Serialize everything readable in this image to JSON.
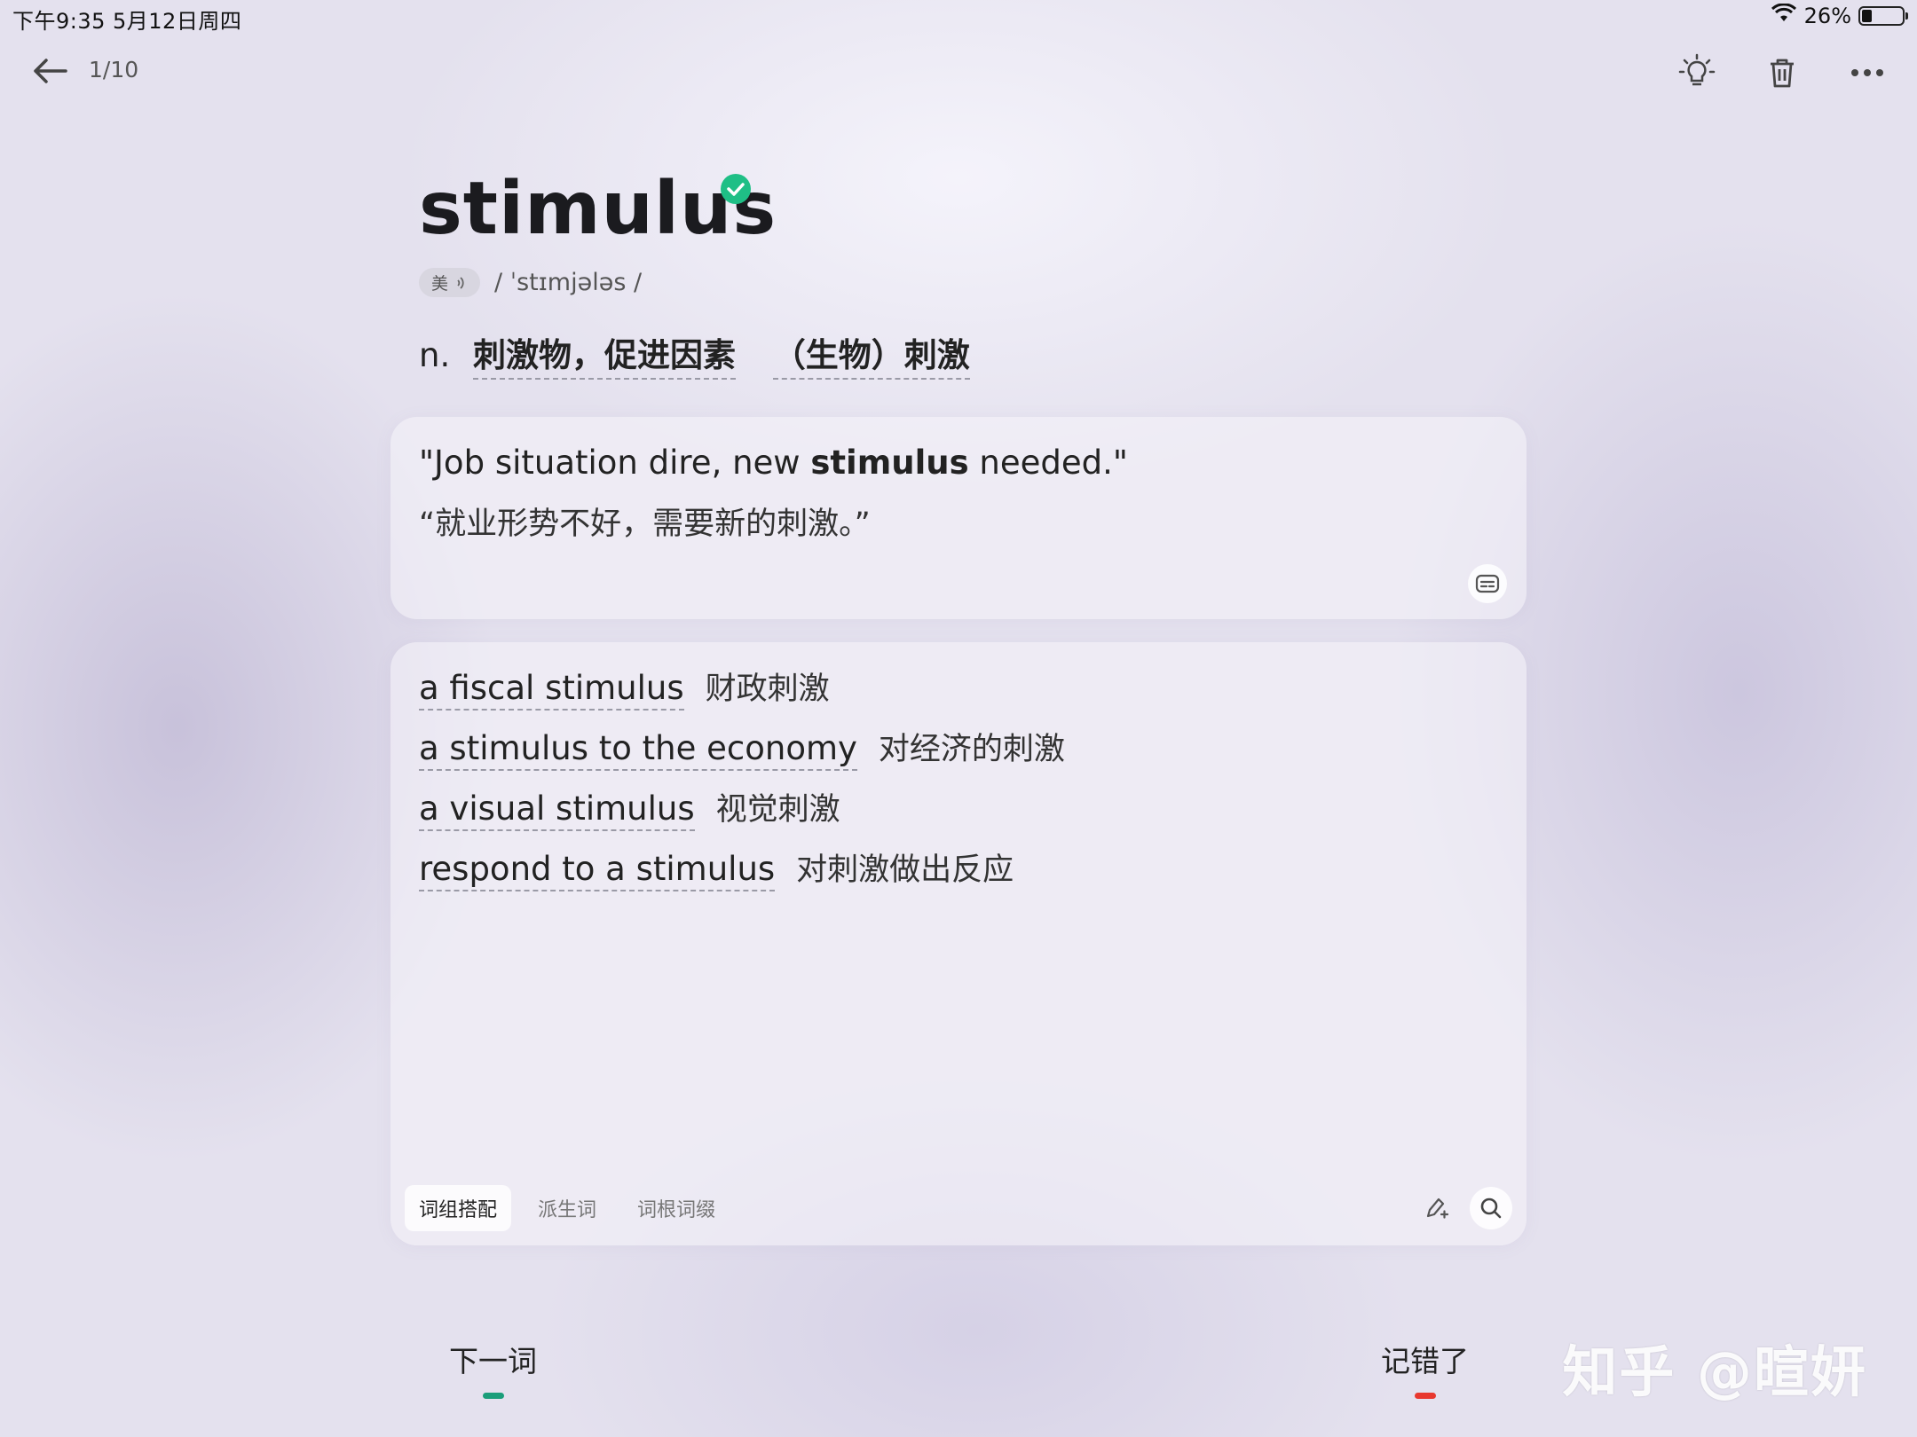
{
  "status_bar": {
    "time_date": "下午9:35   5月12日周四",
    "battery": "26%",
    "battery_level": 0.26
  },
  "topbar": {
    "progress": "1/10"
  },
  "word": {
    "headword": "stimulus",
    "accent_label": "美",
    "phonetic": "/ ˈstɪmjələs /",
    "pos": "n.",
    "definitions": [
      "刺激物，促进因素",
      "（生物）刺激"
    ]
  },
  "example": {
    "en_before": "\"Job situation dire, new ",
    "en_bold": "stimulus",
    "en_after": " needed.\"",
    "zh": "“就业形势不好，需要新的刺激。”"
  },
  "phrases": [
    {
      "en": "a fiscal stimulus",
      "zh": "财政刺激"
    },
    {
      "en": "a stimulus to the economy",
      "zh": "对经济的刺激"
    },
    {
      "en": "a visual stimulus",
      "zh": "视觉刺激"
    },
    {
      "en": "respond to a stimulus",
      "zh": "对刺激做出反应"
    }
  ],
  "tabs": [
    "词组搭配",
    "派生词",
    "词根词缀"
  ],
  "bottom": {
    "next_label": "下一词",
    "wrong_label": "记错了"
  },
  "watermark": "知乎 @暄妍",
  "colors": {
    "accent_green": "#1fbf86",
    "next_bar": "#1a9e7a",
    "wrong_bar": "#e8382f"
  }
}
